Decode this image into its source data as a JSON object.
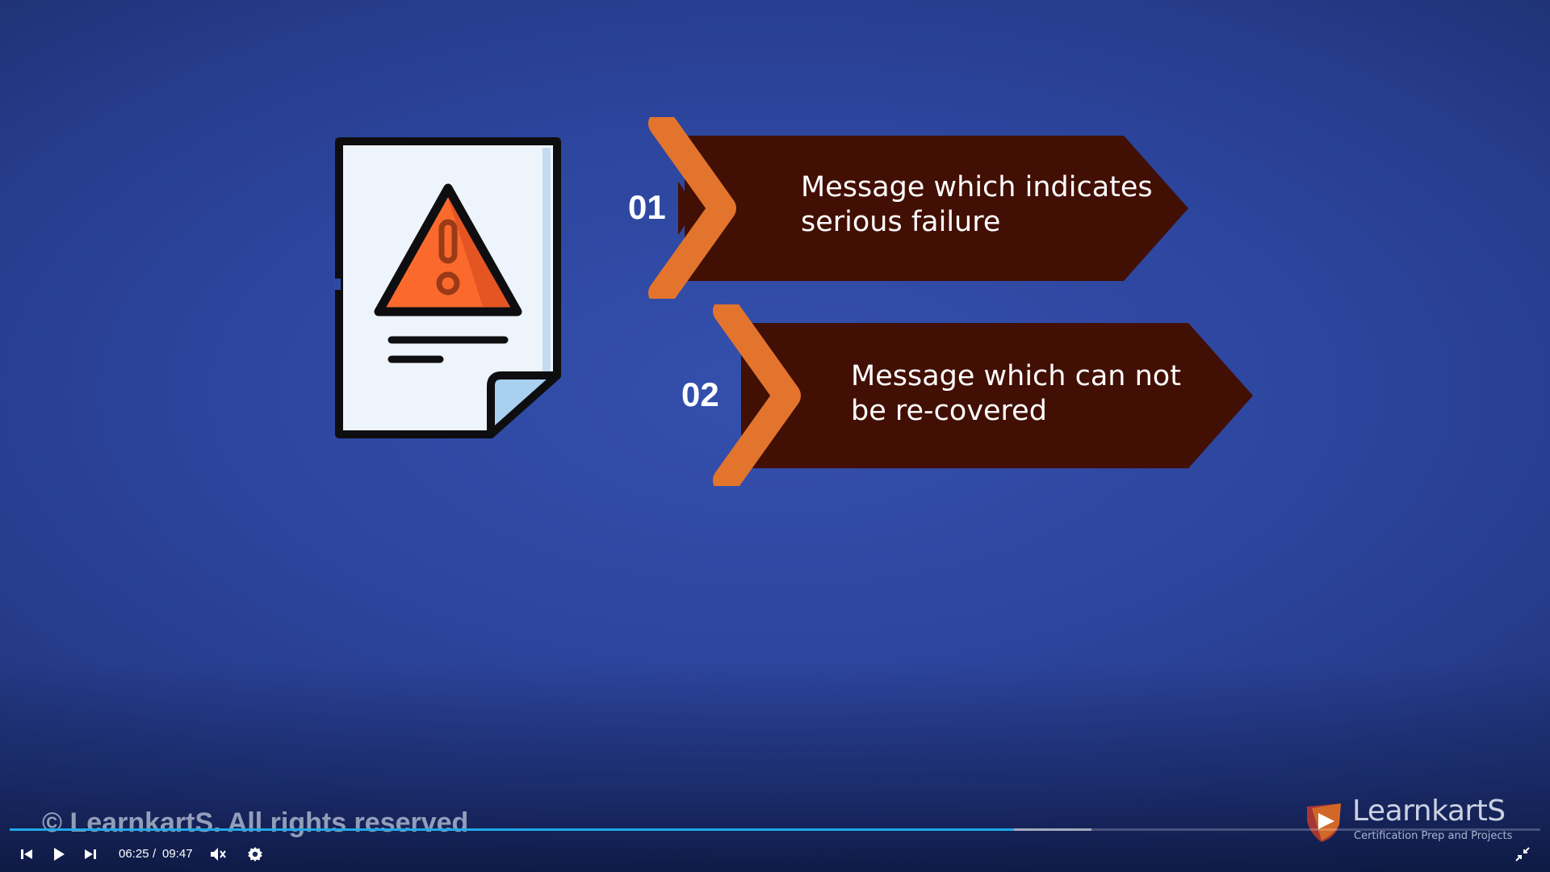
{
  "slide": {
    "items": [
      {
        "number": "01",
        "text": "Message which indicates\nserious failure"
      },
      {
        "number": "02",
        "text": "Message which can not\nbe re-covered"
      }
    ],
    "colors": {
      "arrow_body": "#420f05",
      "chevron": "#e2742d",
      "warning_fill": "#fb6a2c",
      "warning_shade": "#e45523",
      "document": "#eef4fb",
      "document_fold": "#a9d0ee",
      "outline": "#0e0e10"
    }
  },
  "watermark": {
    "copyright": "© LearnkartS. All rights reserved",
    "brand_name": "LearnkartS",
    "brand_tagline": "Certification Prep and Projects"
  },
  "player": {
    "current_time": "06:25",
    "separator": "/",
    "duration": "09:47",
    "played_fraction": 0.656,
    "buffered_fraction": 0.707,
    "progress_color": "#1fa8e6",
    "icons": {
      "previous": "skip-previous-icon",
      "play": "play-icon",
      "next": "skip-next-icon",
      "volume": "volume-icon",
      "settings": "gear-icon",
      "exit_fullscreen": "exit-fullscreen-icon"
    }
  }
}
